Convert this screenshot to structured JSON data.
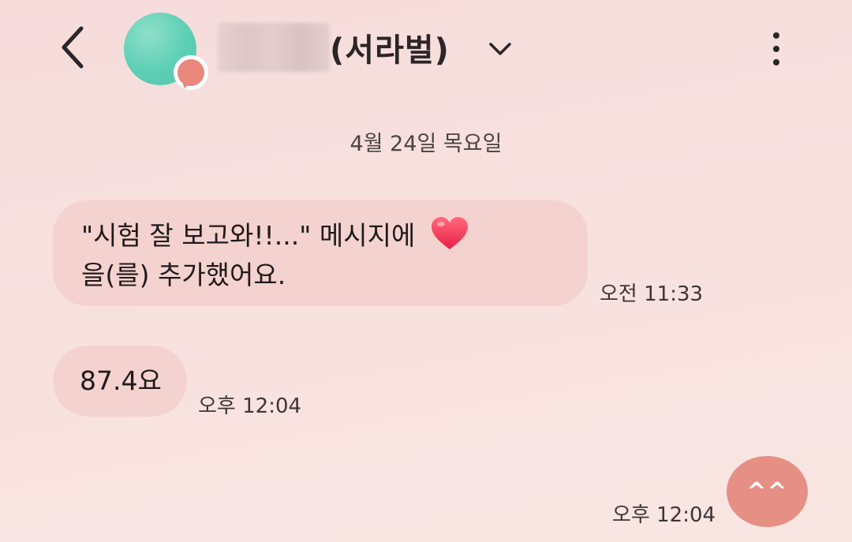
{
  "header": {
    "back_icon": "chevron-left-icon",
    "avatar_badge_icon": "chat-bubble-icon",
    "contact_name_suffix": "(서라벌)",
    "dropdown_icon": "chevron-down-icon",
    "more_icon": "more-vertical-icon"
  },
  "conversation": {
    "date_divider": "4월 24일 목요일",
    "messages": [
      {
        "direction": "incoming",
        "text_line1": "\"시험 잘 보고와!!...\" 메시지에",
        "reaction_icon": "heart-icon",
        "text_line2": "을(를) 추가했어요.",
        "time": "오전 11:33"
      },
      {
        "direction": "incoming",
        "text": "87.4요",
        "time": "오후 12:04"
      },
      {
        "direction": "outgoing",
        "text": "^^",
        "time": "오후 12:04"
      }
    ]
  },
  "colors": {
    "background": "#f7e0de",
    "incoming_bubble": "#f4d2cf",
    "outgoing_bubble": "#e68f84",
    "avatar": "#5ccfb4",
    "badge": "#e9877d"
  }
}
